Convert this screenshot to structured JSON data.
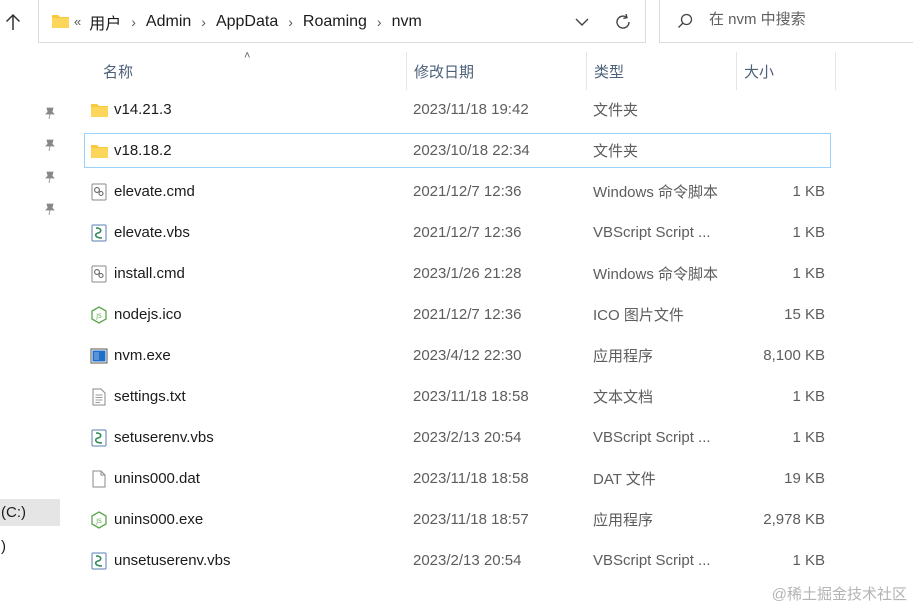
{
  "address_bar": {
    "overflow_label": "«",
    "breadcrumbs": [
      "用户",
      "Admin",
      "AppData",
      "Roaming",
      "nvm"
    ]
  },
  "search": {
    "placeholder": "在 nvm 中搜索"
  },
  "columns": {
    "name": "名称",
    "date": "修改日期",
    "type": "类型",
    "size": "大小"
  },
  "files": [
    {
      "icon": "folder-icon",
      "name": "v14.21.3",
      "date": "2023/11/18 19:42",
      "type": "文件夹",
      "size": ""
    },
    {
      "icon": "folder-icon",
      "name": "v18.18.2",
      "date": "2023/10/18 22:34",
      "type": "文件夹",
      "size": "",
      "selected": true
    },
    {
      "icon": "cmd-file-icon",
      "name": "elevate.cmd",
      "date": "2021/12/7 12:36",
      "type": "Windows 命令脚本",
      "size": "1 KB"
    },
    {
      "icon": "vbs-file-icon",
      "name": "elevate.vbs",
      "date": "2021/12/7 12:36",
      "type": "VBScript Script ...",
      "size": "1 KB"
    },
    {
      "icon": "cmd-file-icon",
      "name": "install.cmd",
      "date": "2023/1/26 21:28",
      "type": "Windows 命令脚本",
      "size": "1 KB"
    },
    {
      "icon": "nodejs-file-icon",
      "name": "nodejs.ico",
      "date": "2021/12/7 12:36",
      "type": "ICO 图片文件",
      "size": "15 KB"
    },
    {
      "icon": "exe-file-icon",
      "name": "nvm.exe",
      "date": "2023/4/12 22:30",
      "type": "应用程序",
      "size": "8,100 KB"
    },
    {
      "icon": "txt-file-icon",
      "name": "settings.txt",
      "date": "2023/11/18 18:58",
      "type": "文本文档",
      "size": "1 KB"
    },
    {
      "icon": "vbs-file-icon",
      "name": "setuserenv.vbs",
      "date": "2023/2/13 20:54",
      "type": "VBScript Script ...",
      "size": "1 KB"
    },
    {
      "icon": "blank-file-icon",
      "name": "unins000.dat",
      "date": "2023/11/18 18:58",
      "type": "DAT 文件",
      "size": "19 KB"
    },
    {
      "icon": "nodejs-file-icon",
      "name": "unins000.exe",
      "date": "2023/11/18 18:57",
      "type": "应用程序",
      "size": "2,978 KB"
    },
    {
      "icon": "vbs-file-icon",
      "name": "unsetuserenv.vbs",
      "date": "2023/2/13 20:54",
      "type": "VBScript Script ...",
      "size": "1 KB"
    }
  ],
  "nav": {
    "drive_fragment": "(C:)",
    "second_fragment": ")"
  },
  "watermark": "@稀土掘金技术社区",
  "colors": {
    "folder": "#f8c93c",
    "selection_border": "#99d1ff",
    "header_text": "#4c607a",
    "nodejs_green": "#5aa64a"
  }
}
